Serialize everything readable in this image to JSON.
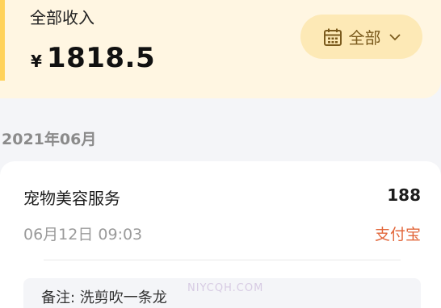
{
  "header": {
    "title": "全部收入",
    "currency_symbol": "¥",
    "amount": "1818.5",
    "filter": {
      "label": "全部",
      "icon": "calendar-icon",
      "chevron_icon": "chevron-down-icon"
    },
    "accent_color": "#ffd25a"
  },
  "month_group": {
    "label": "2021年06月",
    "records": [
      {
        "service": "宠物美容服务",
        "price": "188",
        "datetime": "06月12日 09:03",
        "payment_method": "支付宝",
        "payment_color": "#e2673b",
        "note": "备注: 洗剪吹一条龙"
      }
    ]
  },
  "watermark": "NIYCQH.COM"
}
